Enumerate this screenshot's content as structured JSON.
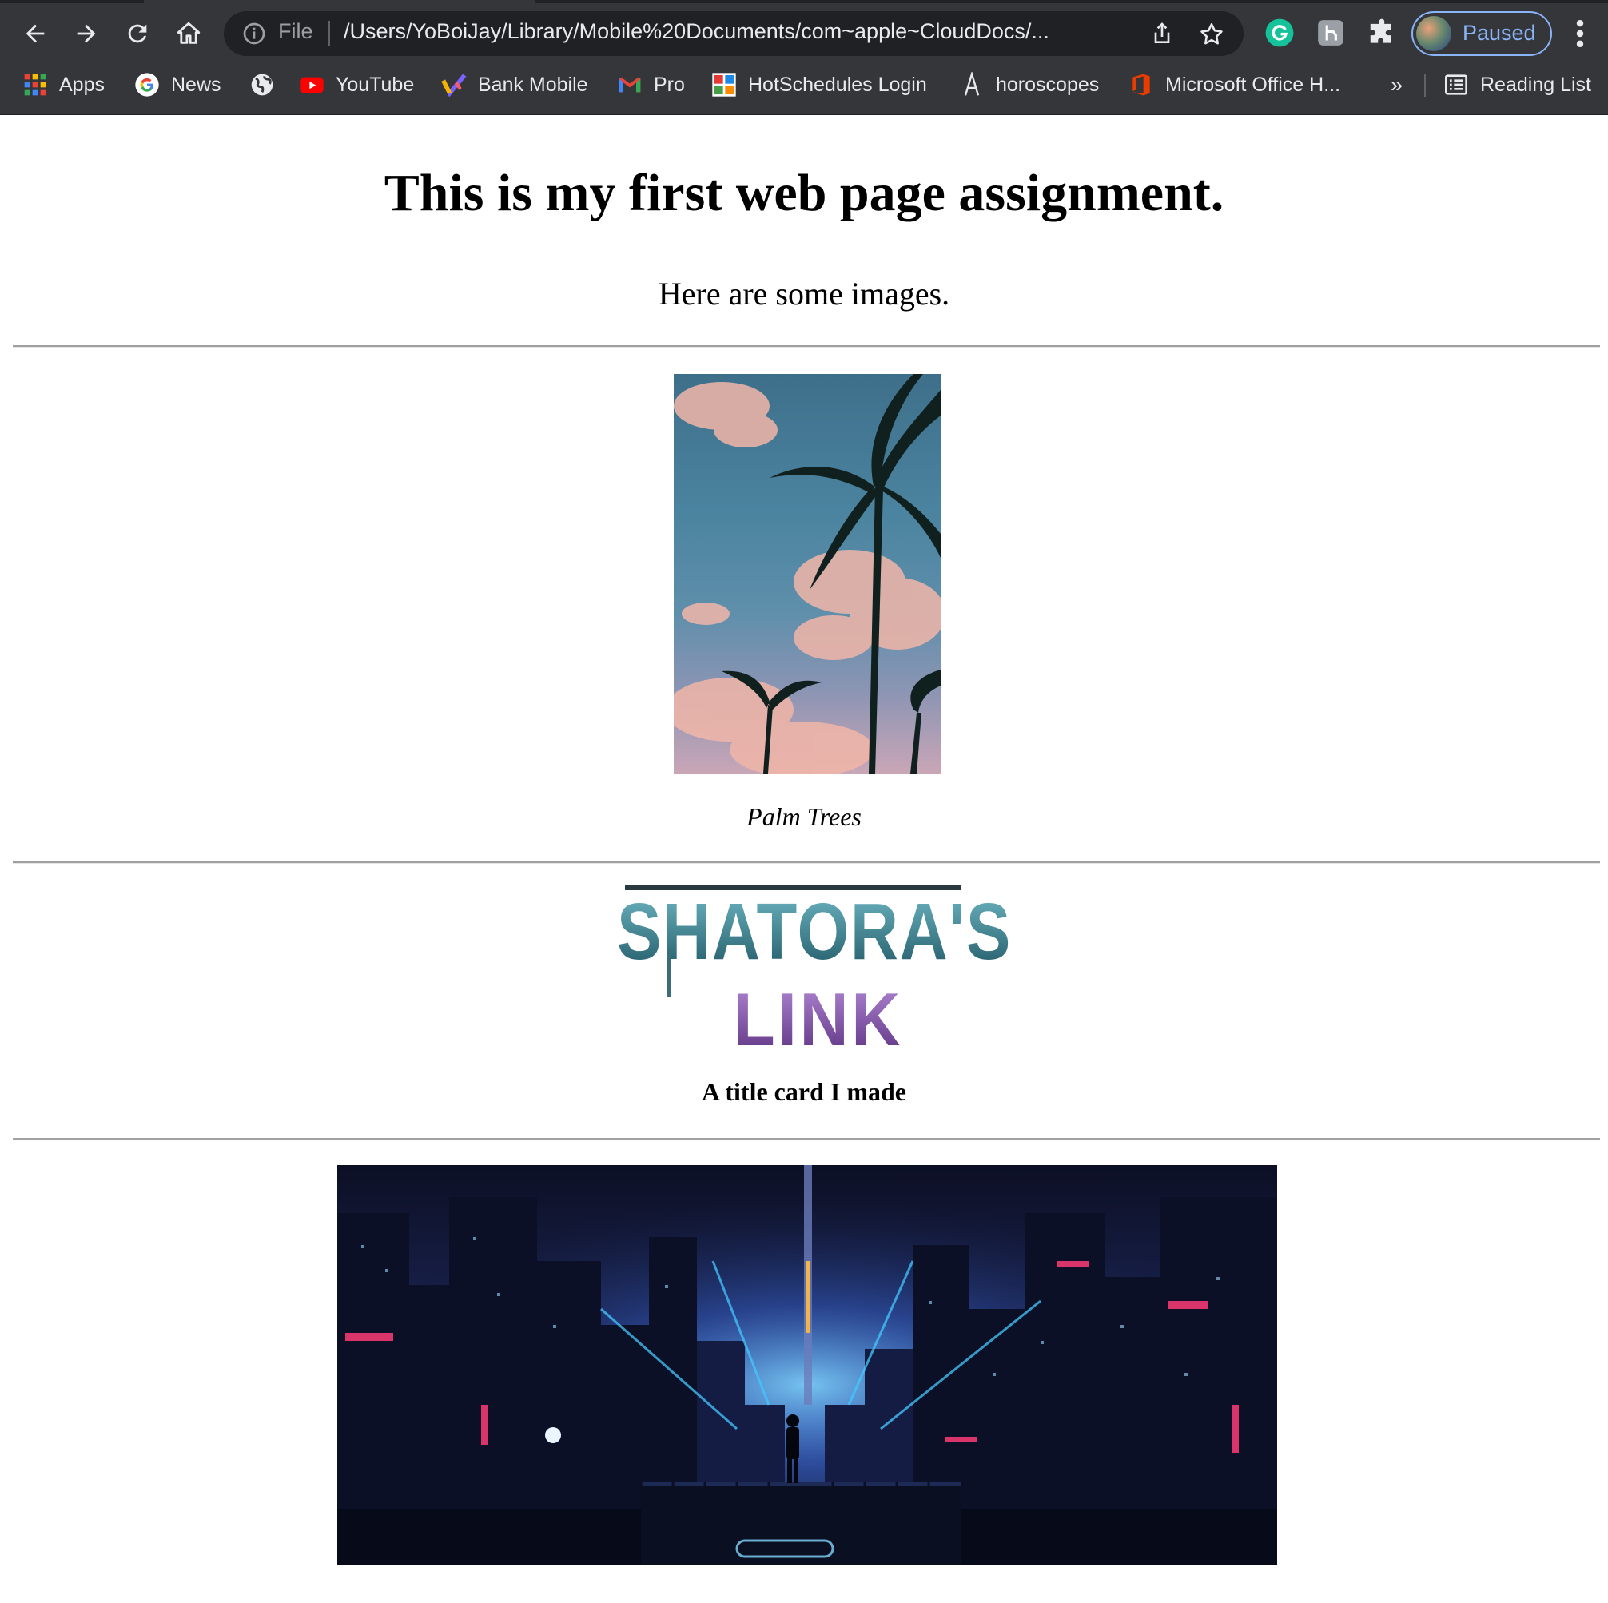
{
  "browser": {
    "omnibox": {
      "scheme_label": "File",
      "url": "/Users/YoBoiJay/Library/Mobile%20Documents/com~apple~CloudDocs/..."
    },
    "profile": {
      "status": "Paused"
    },
    "bookmarks": [
      {
        "label": "Apps",
        "icon": "apps-grid-icon"
      },
      {
        "label": "News",
        "icon": "google-icon"
      },
      {
        "label": "",
        "icon": "globe-icon"
      },
      {
        "label": "YouTube",
        "icon": "youtube-icon"
      },
      {
        "label": "Bank Mobile",
        "icon": "bank-mobile-icon"
      },
      {
        "label": "Pro",
        "icon": "gmail-icon"
      },
      {
        "label": "HotSchedules Login",
        "icon": "hotschedules-icon"
      },
      {
        "label": "horoscopes",
        "icon": "horoscopes-icon"
      },
      {
        "label": "Microsoft Office H...",
        "icon": "office-icon"
      }
    ],
    "more_bookmarks": "»",
    "reading_list": "Reading List"
  },
  "page": {
    "heading": "This is my first web page assignment.",
    "intro": "Here are some images.",
    "images": [
      {
        "caption": "Palm Trees"
      },
      {
        "caption": "A title card I made",
        "logo_text": [
          "SHATORA'S",
          "LINK"
        ]
      },
      {
        "caption": ""
      }
    ]
  },
  "colors": {
    "chrome_bg": "#35363a",
    "omnibox_bg": "#202124",
    "profile_accent": "#8ab4f8"
  }
}
